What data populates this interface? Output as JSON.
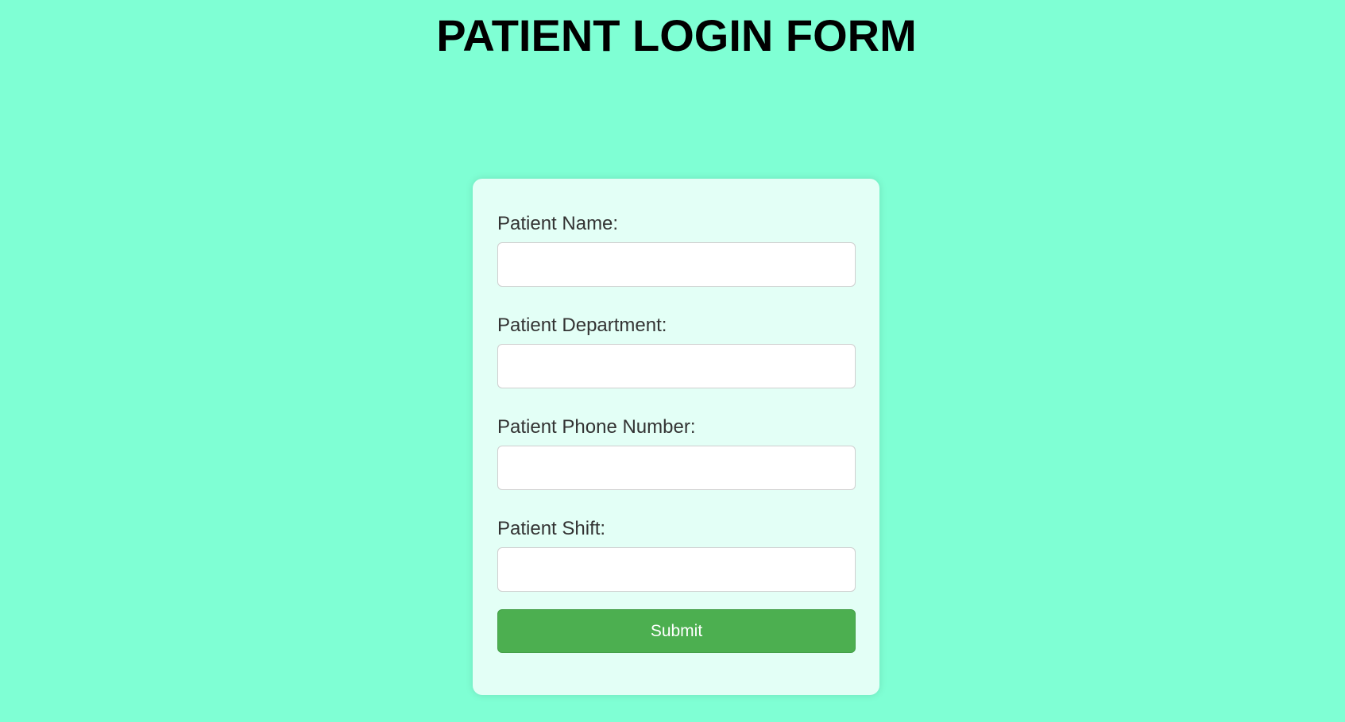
{
  "page": {
    "title": "PATIENT LOGIN FORM",
    "background_color": "#7fffd4"
  },
  "form": {
    "card_color": "#e3fff6",
    "fields": [
      {
        "label": "Patient Name:",
        "value": "",
        "placeholder": ""
      },
      {
        "label": "Patient Department:",
        "value": "",
        "placeholder": ""
      },
      {
        "label": "Patient Phone Number:",
        "value": "",
        "placeholder": ""
      },
      {
        "label": "Patient Shift:",
        "value": "",
        "placeholder": ""
      }
    ],
    "submit_label": "Submit",
    "submit_color": "#4caf50"
  }
}
